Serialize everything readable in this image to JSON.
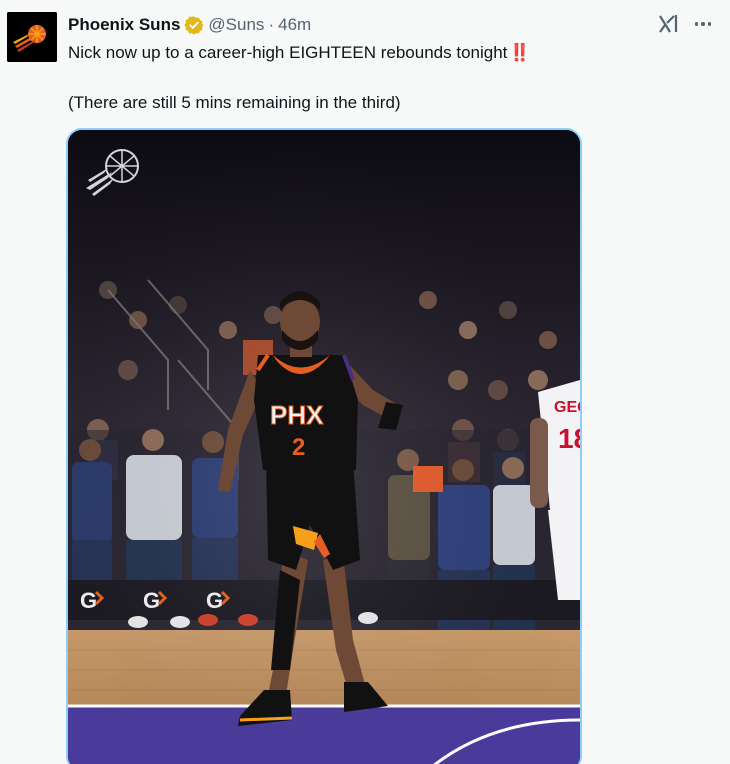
{
  "tweet": {
    "author": {
      "display_name": "Phoenix Suns",
      "handle": "@Suns",
      "separator": "·",
      "time": "46m",
      "avatar_icon": "phoenix-suns-logo-icon",
      "verified_icon": "verified-badge-icon"
    },
    "text_line1": "Nick now up to a career-high EIGHTEEN rebounds tonight",
    "emoji": "‼️",
    "text_line2": "(There are still 5 mins remaining in the third)",
    "actions": {
      "grok_icon": "grok-icon",
      "more_icon": "more-options-icon"
    },
    "media": {
      "type": "photo",
      "jersey_wordmark": "PHX",
      "jersey_number": "2",
      "opponent_name_fragment": "GEOR",
      "opponent_number_fragment": "18",
      "sponsor_letter": "G",
      "colors": {
        "suns_orange": "#e56020",
        "suns_purple": "#4b2e83",
        "court_wood": "#b98a5a",
        "court_purple": "#4a3a9c",
        "jersey_black": "#111111"
      }
    }
  },
  "colors": {
    "background": "#f7f9f9",
    "text_primary": "#0f1419",
    "text_secondary": "#536471",
    "verified_gold": "#e2b719",
    "media_border": "#8ecdf8"
  }
}
